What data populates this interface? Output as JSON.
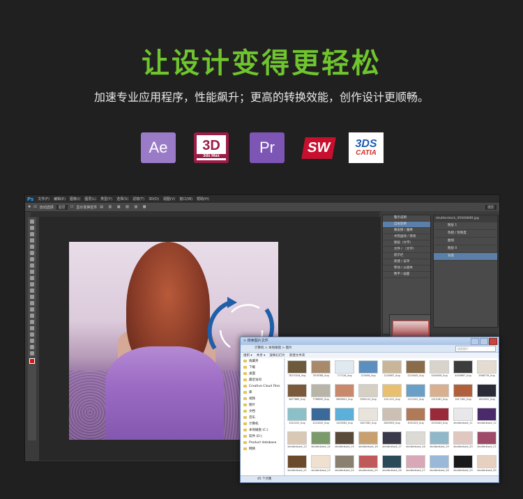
{
  "headline": "让设计变得更轻松",
  "subtitle": "加速专业应用程序，性能飙升；更高的转换效能，创作设计更顺畅。",
  "apps": {
    "ae": "Ae",
    "max": "3D",
    "max_sub": "3ds Max",
    "pr": "Pr",
    "sw": "SW",
    "catia_logo": "3DS",
    "catia": "CATIA"
  },
  "photoshop": {
    "logo": "Ps",
    "menu": [
      "文件(F)",
      "编辑(E)",
      "图像(I)",
      "图层(L)",
      "类型(Y)",
      "选择(S)",
      "滤镜(T)",
      "3D(D)",
      "视图(V)",
      "窗口(W)",
      "帮助(H)"
    ],
    "options": {
      "auto_select": "自动选择",
      "group": "图层",
      "show_transform": "显示变换控件",
      "workspace": "摄影"
    },
    "history_items": [
      "警示说明",
      "自由变换",
      "橡皮擦 / 魔棒",
      "木刻画效 / 蒸效",
      "图层（文字）",
      "文件 / （文字）",
      "提示栏",
      "新建 / 菜单",
      "移动 / 从副本",
      "数字 / 画面"
    ],
    "history_zoom": "16.67%",
    "layers_title": "shutterstock_45044849.jpg",
    "layers": [
      "图层 1",
      "色相 / 饱和度",
      "曲线",
      "图层 0",
      "背景"
    ]
  },
  "explorer": {
    "title": "> 搜索图片文件",
    "address": "计算机 > 本地磁盘 > 图片",
    "search_placeholder": "搜索图片",
    "toolbar": [
      "组织 ▾",
      "共享 ▾",
      "放映幻灯片",
      "新建文件夹"
    ],
    "nav": [
      "收藏夹",
      "下载",
      "桌面",
      "最近访问",
      "Creative Cloud Files",
      "库",
      "视频",
      "图片",
      "文档",
      "音乐",
      "计算机",
      "本地磁盘 (C:)",
      "软件 (D:)",
      "Product database",
      "网络"
    ],
    "files": [
      {
        "name": "7817020t_0ug",
        "color": "#6d5a3c"
      },
      {
        "name": "7878788_0ug",
        "color": "#a88a6a"
      },
      {
        "name": "777128_0ug",
        "color": "#e0e8f0"
      },
      {
        "name": "223456_0ug",
        "color": "#5c8fbf"
      },
      {
        "name": "1234567_0ug",
        "color": "#c9b59a"
      },
      {
        "name": "2233445_0ug",
        "color": "#8a6b4a"
      },
      {
        "name": "3344556_0ug",
        "color": "#d8d4cc"
      },
      {
        "name": "4455667_0ug",
        "color": "#3c3c3c"
      },
      {
        "name": "5566778_0ug",
        "color": "#e4dcd0"
      },
      {
        "name": "6677889_0ug",
        "color": "#7a5a3a"
      },
      {
        "name": "7788990_0ug",
        "color": "#b8b4a8"
      },
      {
        "name": "8899001_0ug",
        "color": "#c88a6a"
      },
      {
        "name": "9900112_0ug",
        "color": "#d6d0c4"
      },
      {
        "name": "1011121_0ug",
        "color": "#e8c070"
      },
      {
        "name": "1213141_0ug",
        "color": "#6aa0c8"
      },
      {
        "name": "1415161_0ug",
        "color": "#d8b090"
      },
      {
        "name": "1617181_0ug",
        "color": "#b0603a"
      },
      {
        "name": "1819202_0ug",
        "color": "#2a2a38"
      },
      {
        "name": "2021222_0ug",
        "color": "#8ac0c8"
      },
      {
        "name": "2223242_0ug",
        "color": "#3a6a9a"
      },
      {
        "name": "2425262_0ug",
        "color": "#5ab0d8"
      },
      {
        "name": "2627282_0ug",
        "color": "#e8e4dc"
      },
      {
        "name": "2829303_0ug",
        "color": "#ccc0b4"
      },
      {
        "name": "3031323_0ug",
        "color": "#b07a58"
      },
      {
        "name": "3233343_0ug",
        "color": "#9a2a3a"
      },
      {
        "name": "shutterstock_11",
        "color": "#e8e8ec"
      },
      {
        "name": "shutterstock_12",
        "color": "#4a2a6a"
      },
      {
        "name": "shutterstock_13",
        "color": "#d8c8b4"
      },
      {
        "name": "shutterstock_14",
        "color": "#7a9a6a"
      },
      {
        "name": "shutterstock_15",
        "color": "#5a4a3a"
      },
      {
        "name": "shutterstock_16",
        "color": "#c8a070"
      },
      {
        "name": "shutterstock_17",
        "color": "#3a3a4a"
      },
      {
        "name": "shutterstock_18",
        "color": "#dcdad4"
      },
      {
        "name": "shutterstock_19",
        "color": "#90b8c8"
      },
      {
        "name": "shutterstock_20",
        "color": "#e0c8c0"
      },
      {
        "name": "shutterstock_21",
        "color": "#a04a6a"
      },
      {
        "name": "shutterstock_22",
        "color": "#6a4a2a"
      },
      {
        "name": "shutterstock_23",
        "color": "#f0e0d0"
      },
      {
        "name": "shutterstock_24",
        "color": "#8a8070"
      },
      {
        "name": "shutterstock_25",
        "color": "#c05a5a"
      },
      {
        "name": "shutterstock_26",
        "color": "#2a4a5a"
      },
      {
        "name": "shutterstock_27",
        "color": "#d8a8b8"
      },
      {
        "name": "shutterstock_28",
        "color": "#9ab8d8"
      },
      {
        "name": "shutterstock_29",
        "color": "#1a1a1a"
      },
      {
        "name": "shutterstock_30",
        "color": "#e8d0c0"
      }
    ],
    "status": "45 个对象"
  }
}
